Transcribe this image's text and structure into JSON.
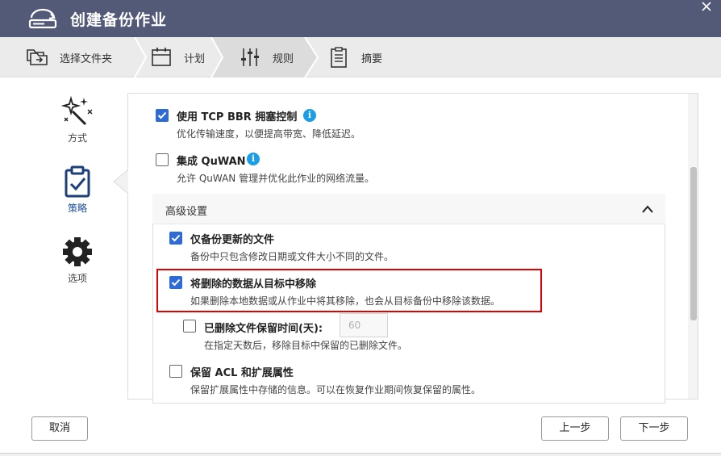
{
  "window": {
    "title": "创建备份作业"
  },
  "steps": [
    {
      "label": "选择文件夹",
      "icon": "folder-copy-icon"
    },
    {
      "label": "计划",
      "icon": "calendar-icon"
    },
    {
      "label": "规则",
      "icon": "sliders-icon"
    },
    {
      "label": "摘要",
      "icon": "clipboard-list-icon"
    }
  ],
  "nav": [
    {
      "label": "方式",
      "icon": "magic-wand-icon"
    },
    {
      "label": "策略",
      "icon": "clipboard-check-icon"
    },
    {
      "label": "选项",
      "icon": "gear-icon"
    }
  ],
  "options": {
    "tcp_bbr": {
      "label": "使用 TCP BBR 拥塞控制",
      "desc": "优化传输速度，以便提高带宽、降低延迟。",
      "checked": true
    },
    "quwan": {
      "label": "集成 QuWAN",
      "desc": "允许 QuWAN 管理并优化此作业的网络流量。",
      "checked": false
    }
  },
  "advanced": {
    "title": "高级设置",
    "items": {
      "backup_updated": {
        "label": "仅备份更新的文件",
        "desc": "备份中只包含修改日期或文件大小不同的文件。",
        "checked": true
      },
      "remove_deleted": {
        "label": "将删除的数据从目标中移除",
        "desc": "如果删除本地数据或从作业中将其移除，也会从目标备份中移除该数据。",
        "checked": true
      },
      "retain_days": {
        "label": "已删除文件保留时间(天):",
        "desc": "在指定天数后，移除目标中保留的已删除文件。",
        "checked": false,
        "value": "60"
      },
      "keep_acl": {
        "label": "保留 ACL 和扩展属性",
        "desc": "保留扩展属性中存储的信息。可以在恢复作业期间恢复保留的属性。",
        "checked": false
      }
    }
  },
  "footer": {
    "cancel": "取消",
    "prev": "上一步",
    "next": "下一步"
  },
  "colors": {
    "titlebar": "#525a78",
    "accent": "#2f6bd6",
    "info": "#1a9ee8",
    "highlight": "#e00000"
  }
}
